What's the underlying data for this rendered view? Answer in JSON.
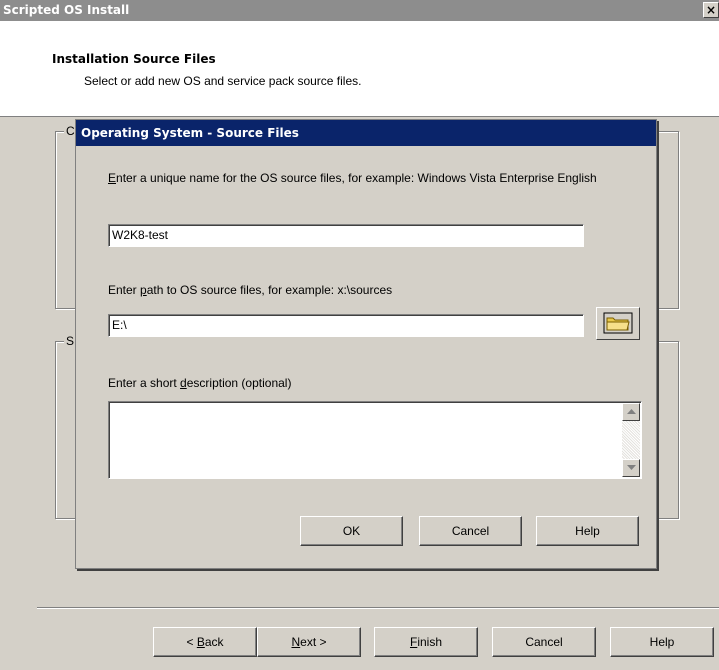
{
  "window": {
    "title": "Scripted OS Install",
    "close_glyph": "×"
  },
  "header": {
    "title": "Installation Source Files",
    "subtitle": "Select or add new OS and service pack source files."
  },
  "groups": {
    "top_label": "C",
    "bottom_label": "S"
  },
  "wizard_buttons": {
    "back": {
      "prefix": "< ",
      "key": "B",
      "rest": "ack"
    },
    "next": {
      "key": "N",
      "rest": "ext >"
    },
    "finish": {
      "key": "F",
      "rest": "inish"
    },
    "cancel": "Cancel",
    "help": "Help"
  },
  "dialog": {
    "title": "Operating System - Source Files",
    "name_prompt": {
      "key": "E",
      "rest": "nter a unique name for the OS source files, for example: Windows Vista Enterprise English"
    },
    "name_value": "W2K8-test",
    "path_prompt": {
      "before": "Enter ",
      "key": "p",
      "after": "ath to OS source files, for example: x:\\sources"
    },
    "path_value": "E:\\",
    "browse_icon": "folder-icon",
    "desc_prompt": {
      "before": "Enter a short ",
      "key": "d",
      "after": "escription (optional)"
    },
    "desc_value": "",
    "buttons": {
      "ok": "OK",
      "cancel": "Cancel",
      "help": "Help"
    }
  }
}
